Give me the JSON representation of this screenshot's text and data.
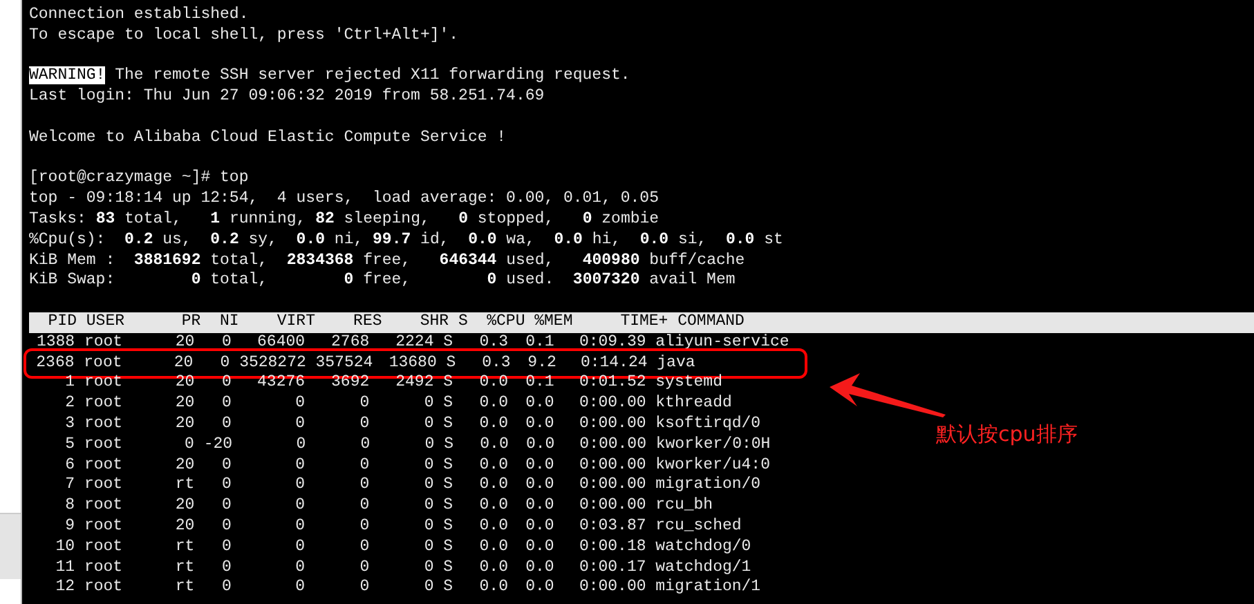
{
  "terminal": {
    "lines": [
      {
        "kind": "text",
        "text": "Connection established."
      },
      {
        "kind": "text",
        "text": "To escape to local shell, press 'Ctrl+Alt+]'."
      },
      {
        "kind": "blank"
      },
      {
        "kind": "warning",
        "tag": "WARNING!",
        "text": "The remote SSH server rejected X11 forwarding request."
      },
      {
        "kind": "text",
        "text": "Last login: Thu Jun 27 09:06:32 2019 from 58.251.74.69"
      },
      {
        "kind": "blank"
      },
      {
        "kind": "text",
        "text": "Welcome to Alibaba Cloud Elastic Compute Service !"
      },
      {
        "kind": "blank"
      },
      {
        "kind": "text",
        "text": "[root@crazymage ~]# top"
      },
      {
        "kind": "text",
        "text": "top - 09:18:14 up 12:54,  4 users,  load average: 0.00, 0.01, 0.05"
      },
      {
        "kind": "text",
        "text": "Tasks: **83** total,   **1** running, **82** sleeping,   **0** stopped,   **0** zombie"
      },
      {
        "kind": "text",
        "text": "%Cpu(s):  **0.2** us,  **0.2** sy,  **0.0** ni, **99.7** id,  **0.0** wa,  **0.0** hi,  **0.0** si,  **0.0** st"
      },
      {
        "kind": "text",
        "text": "KiB Mem :  **3881692** total,  **2834368** free,   **646344** used,   **400980** buff/cache"
      },
      {
        "kind": "text",
        "text": "KiB Swap:        **0** total,        **0** free,        **0** used.  **3007320** avail Mem"
      },
      {
        "kind": "blank"
      }
    ],
    "process_table": {
      "columns": [
        "PID",
        "USER",
        "PR",
        "NI",
        "VIRT",
        "RES",
        "SHR",
        "S",
        "%CPU",
        "%MEM",
        "TIME+",
        "COMMAND"
      ],
      "rows": [
        {
          "highlighted": false,
          "cells": [
            "1388",
            "root",
            "20",
            "0",
            "66400",
            "2768",
            "2224",
            "S",
            "0.3",
            "0.1",
            "0:09.39",
            "aliyun-service"
          ]
        },
        {
          "highlighted": true,
          "cells": [
            "2368",
            "root",
            "20",
            "0",
            "3528272",
            "357524",
            "13680",
            "S",
            "0.3",
            "9.2",
            "0:14.24",
            "java"
          ]
        },
        {
          "highlighted": false,
          "cells": [
            "1",
            "root",
            "20",
            "0",
            "43276",
            "3692",
            "2492",
            "S",
            "0.0",
            "0.1",
            "0:01.52",
            "systemd"
          ]
        },
        {
          "highlighted": false,
          "cells": [
            "2",
            "root",
            "20",
            "0",
            "0",
            "0",
            "0",
            "S",
            "0.0",
            "0.0",
            "0:00.00",
            "kthreadd"
          ]
        },
        {
          "highlighted": false,
          "cells": [
            "3",
            "root",
            "20",
            "0",
            "0",
            "0",
            "0",
            "S",
            "0.0",
            "0.0",
            "0:00.00",
            "ksoftirqd/0"
          ]
        },
        {
          "highlighted": false,
          "cells": [
            "5",
            "root",
            "0",
            "-20",
            "0",
            "0",
            "0",
            "S",
            "0.0",
            "0.0",
            "0:00.00",
            "kworker/0:0H"
          ]
        },
        {
          "highlighted": false,
          "cells": [
            "6",
            "root",
            "20",
            "0",
            "0",
            "0",
            "0",
            "S",
            "0.0",
            "0.0",
            "0:00.00",
            "kworker/u4:0"
          ]
        },
        {
          "highlighted": false,
          "cells": [
            "7",
            "root",
            "rt",
            "0",
            "0",
            "0",
            "0",
            "S",
            "0.0",
            "0.0",
            "0:00.00",
            "migration/0"
          ]
        },
        {
          "highlighted": false,
          "cells": [
            "8",
            "root",
            "20",
            "0",
            "0",
            "0",
            "0",
            "S",
            "0.0",
            "0.0",
            "0:00.00",
            "rcu_bh"
          ]
        },
        {
          "highlighted": false,
          "cells": [
            "9",
            "root",
            "20",
            "0",
            "0",
            "0",
            "0",
            "S",
            "0.0",
            "0.0",
            "0:03.87",
            "rcu_sched"
          ]
        },
        {
          "highlighted": false,
          "cells": [
            "10",
            "root",
            "rt",
            "0",
            "0",
            "0",
            "0",
            "S",
            "0.0",
            "0.0",
            "0:00.18",
            "watchdog/0"
          ]
        },
        {
          "highlighted": false,
          "cells": [
            "11",
            "root",
            "rt",
            "0",
            "0",
            "0",
            "0",
            "S",
            "0.0",
            "0.0",
            "0:00.17",
            "watchdog/1"
          ]
        },
        {
          "highlighted": false,
          "cells": [
            "12",
            "root",
            "rt",
            "0",
            "0",
            "0",
            "0",
            "S",
            "0.0",
            "0.0",
            "0:00.00",
            "migration/1"
          ]
        }
      ]
    }
  },
  "annotation": {
    "text": "默认按cpu排序"
  }
}
